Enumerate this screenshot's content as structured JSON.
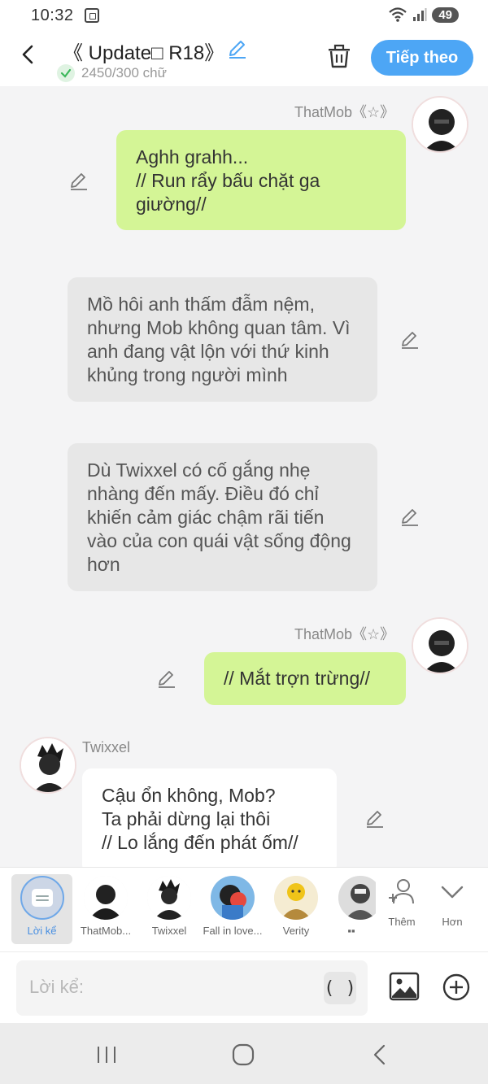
{
  "status_bar": {
    "time": "10:32",
    "battery": "49"
  },
  "header": {
    "title": "《 Update□ R18》",
    "word_count": "2450/300 chữ",
    "next_label": "Tiếp theo"
  },
  "messages": [
    {
      "speaker": "ThatMob《☆》",
      "text": "Aghh grahh...\n// Run rẩy bấu chặt ga giường//"
    },
    {
      "text": "Mồ hôi anh thấm đẫm nệm, nhưng Mob không quan tâm. Vì anh đang vật lộn với thứ kinh khủng trong người mình"
    },
    {
      "text": "Dù Twixxel có cố gắng nhẹ nhàng đến mấy. Điều đó chỉ khiến cảm giác chậm rãi tiến vào của con quái vật sống động hơn"
    },
    {
      "speaker": "ThatMob《☆》",
      "text": "// Mắt trợn trừng//"
    },
    {
      "speaker": "Twixxel",
      "text": "Cậu ổn không, Mob?\nTa phải dừng lại thôi\n// Lo lắng đến phát ốm//"
    }
  ],
  "characters": [
    {
      "label": "Lời kể"
    },
    {
      "label": "ThatMob..."
    },
    {
      "label": "Twixxel"
    },
    {
      "label": "Fall in love..."
    },
    {
      "label": "Verity"
    },
    {
      "label": "▪▪"
    }
  ],
  "char_actions": {
    "add_label": "Thêm",
    "more_label": "Hơn"
  },
  "input": {
    "placeholder": "Lời kể:",
    "paren_label": "( )"
  },
  "colors": {
    "accent": "#4da6f5",
    "self_bubble": "#d4f596",
    "narration_bubble": "#e7e7e7"
  }
}
